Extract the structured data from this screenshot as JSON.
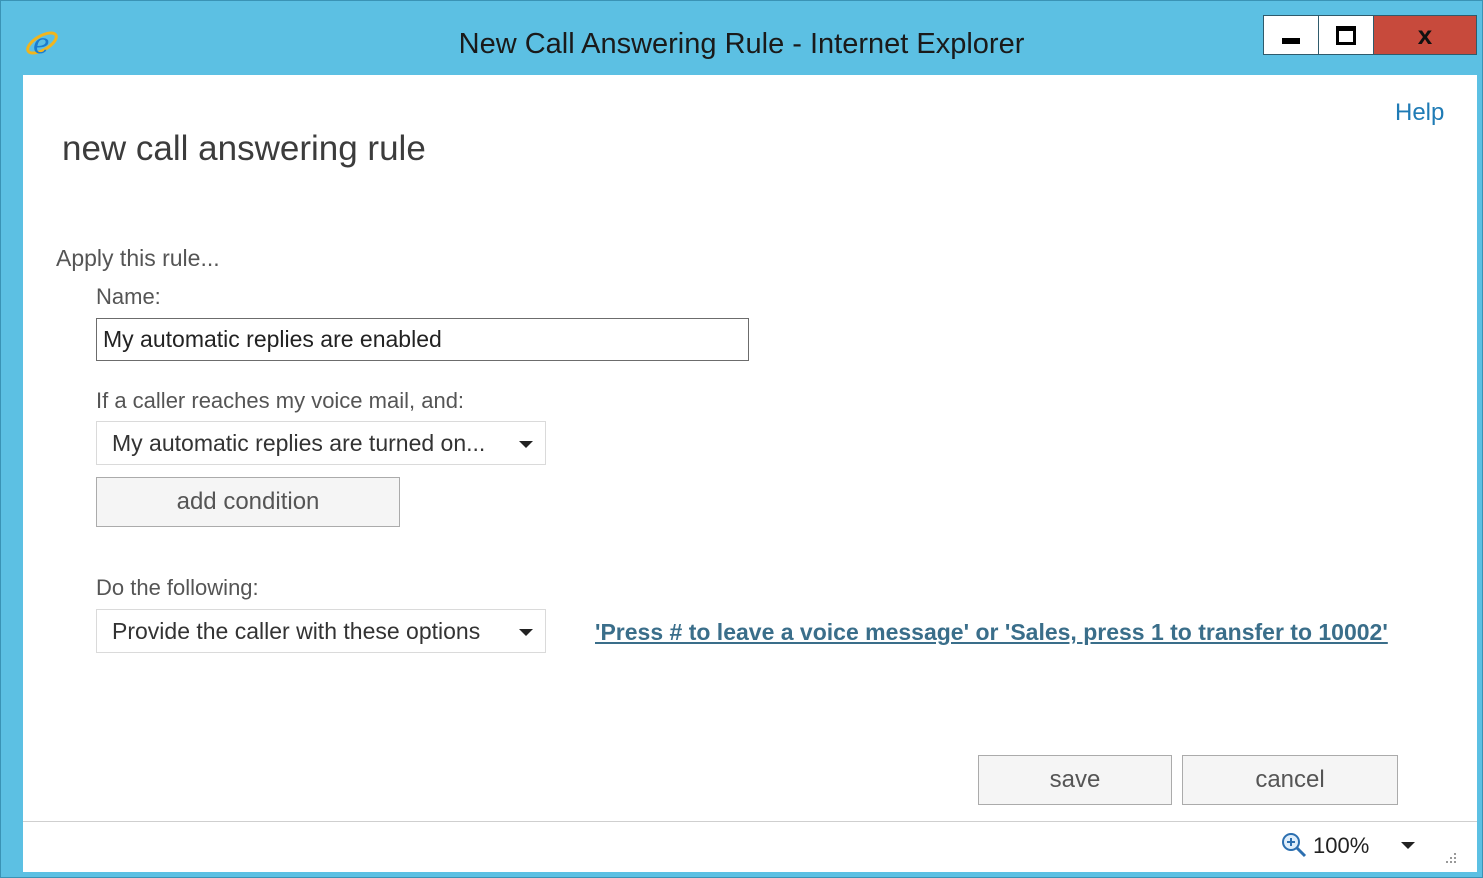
{
  "window": {
    "title": "New Call Answering Rule - Internet Explorer",
    "close_glyph": "x"
  },
  "page": {
    "help_label": "Help",
    "title": "new call answering rule",
    "apply_label": "Apply this rule..."
  },
  "form": {
    "name_label": "Name:",
    "name_value": "My automatic replies are enabled",
    "condition_label": "If a caller reaches my voice mail, and:",
    "condition_selected": "My automatic replies are turned on...",
    "add_condition_label": "add condition",
    "action_label": "Do the following:",
    "action_selected": "Provide the caller with these options",
    "action_link": "'Press # to leave a voice message' or 'Sales, press 1 to transfer to 10002'",
    "save_label": "save",
    "cancel_label": "cancel"
  },
  "statusbar": {
    "zoom": "100%"
  },
  "colors": {
    "frame": "#5cc0e3",
    "close_button": "#c74a3c",
    "link": "#1f7bb5"
  },
  "icons": [
    "ie-logo-icon",
    "minimize-icon",
    "maximize-icon",
    "close-icon",
    "caret-down-icon",
    "zoom-icon",
    "resize-grip-icon"
  ]
}
